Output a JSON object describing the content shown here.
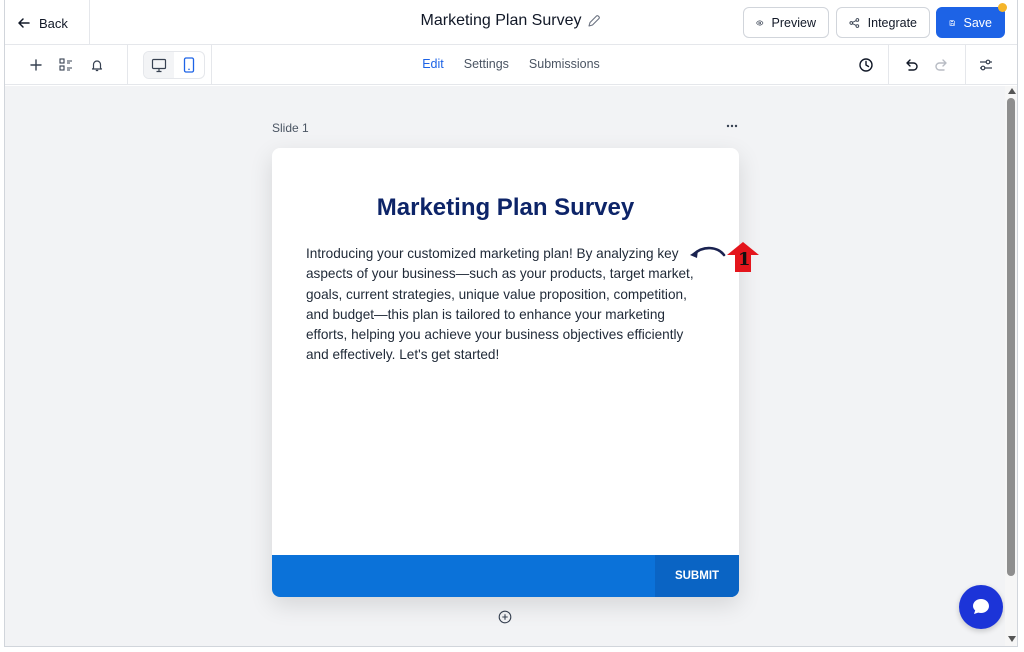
{
  "header": {
    "back_label": "Back",
    "title": "Marketing Plan Survey",
    "preview_label": "Preview",
    "integrate_label": "Integrate",
    "save_label": "Save"
  },
  "toolbar": {
    "tabs": [
      {
        "label": "Edit",
        "active": true
      },
      {
        "label": "Settings",
        "active": false
      },
      {
        "label": "Submissions",
        "active": false
      }
    ],
    "icons": [
      "plus-icon",
      "layers-icon",
      "bell-icon",
      "desktop-icon",
      "mobile-icon",
      "history-icon",
      "undo-icon",
      "redo-icon",
      "sliders-icon"
    ]
  },
  "canvas": {
    "slide_label": "Slide 1",
    "card": {
      "title": "Marketing Plan Survey",
      "body": "Introducing your customized marketing plan! By analyzing key aspects of your business—such as your products, target market, goals, current strategies, unique value proposition, competition, and budget—this plan is tailored to enhance your marketing efforts, helping you achieve your business objectives efficiently and effectively. Let's get started!",
      "submit_label": "SUBMIT"
    },
    "annotation_number": "1"
  },
  "colors": {
    "accent": "#1d63e6",
    "title": "#0d2468",
    "footer": "#0b72d9",
    "submit": "#0a64c4",
    "chat": "#1c34d8",
    "annotation": "#e4151c",
    "notification": "#f5b52a"
  }
}
